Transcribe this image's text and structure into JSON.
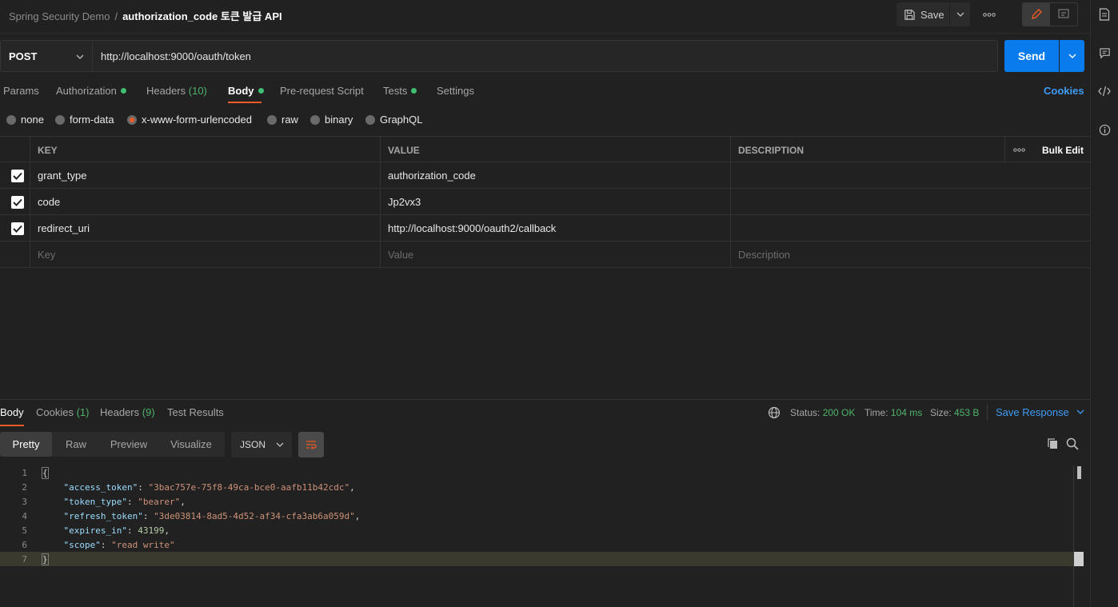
{
  "breadcrumb": {
    "collection": "Spring Security Demo",
    "separator": "/",
    "request": "authorization_code 토큰 발급 API"
  },
  "toolbar": {
    "save_label": "Save"
  },
  "request": {
    "method": "POST",
    "url": "http://localhost:9000/oauth/token",
    "send_label": "Send"
  },
  "tabs": [
    {
      "label": "Params"
    },
    {
      "label": "Authorization"
    },
    {
      "label": "Headers",
      "count": "(10)"
    },
    {
      "label": "Body"
    },
    {
      "label": "Pre-request Script"
    },
    {
      "label": "Tests"
    },
    {
      "label": "Settings"
    }
  ],
  "cookies_label": "Cookies",
  "body_types": [
    "none",
    "form-data",
    "x-www-form-urlencoded",
    "raw",
    "binary",
    "GraphQL"
  ],
  "selected_body_type": "x-www-form-urlencoded",
  "table": {
    "headers": {
      "key": "KEY",
      "value": "VALUE",
      "description": "DESCRIPTION",
      "bulk_edit": "Bulk Edit"
    },
    "rows": [
      {
        "key": "grant_type",
        "value": "authorization_code",
        "checked": true
      },
      {
        "key": "code",
        "value": "Jp2vx3",
        "checked": true
      },
      {
        "key": "redirect_uri",
        "value": "http://localhost:9000/oauth2/callback",
        "checked": true
      }
    ],
    "placeholders": {
      "key": "Key",
      "value": "Value",
      "description": "Description"
    }
  },
  "response": {
    "tabs": [
      {
        "label": "Body"
      },
      {
        "label": "Cookies",
        "count": "(1)"
      },
      {
        "label": "Headers",
        "count": "(9)"
      },
      {
        "label": "Test Results"
      }
    ],
    "status_label": "Status:",
    "status_value": "200 OK",
    "time_label": "Time:",
    "time_value": "104 ms",
    "size_label": "Size:",
    "size_value": "453 B",
    "save_response": "Save Response",
    "format_tabs": [
      "Pretty",
      "Raw",
      "Preview",
      "Visualize"
    ],
    "format": "JSON",
    "code_lines": [
      {
        "n": "1",
        "text": "{"
      },
      {
        "n": "2",
        "key": "\"access_token\"",
        "value": "\"3bac757e-75f8-49ca-bce0-aafb11b42cdc\"",
        "type": "s",
        "tail": ","
      },
      {
        "n": "3",
        "key": "\"token_type\"",
        "value": "\"bearer\"",
        "type": "s",
        "tail": ","
      },
      {
        "n": "4",
        "key": "\"refresh_token\"",
        "value": "\"3de03814-8ad5-4d52-af34-cfa3ab6a059d\"",
        "type": "s",
        "tail": ","
      },
      {
        "n": "5",
        "key": "\"expires_in\"",
        "value": "43199",
        "type": "n",
        "tail": ","
      },
      {
        "n": "6",
        "key": "\"scope\"",
        "value": "\"read write\"",
        "type": "s",
        "tail": ""
      },
      {
        "n": "7",
        "text": "}"
      }
    ]
  },
  "colors": {
    "accent": "#ef5b25",
    "send": "#097bed",
    "link": "#3f9cf5",
    "success": "#4fb36b"
  },
  "icons": [
    "save-icon",
    "chevron-down-icon",
    "more-icon",
    "edit-icon",
    "comment-icon",
    "documentation-icon",
    "code-icon",
    "info-icon",
    "globe-icon",
    "copy-icon",
    "search-icon",
    "wrap-icon",
    "checkbox-checked-icon"
  ]
}
